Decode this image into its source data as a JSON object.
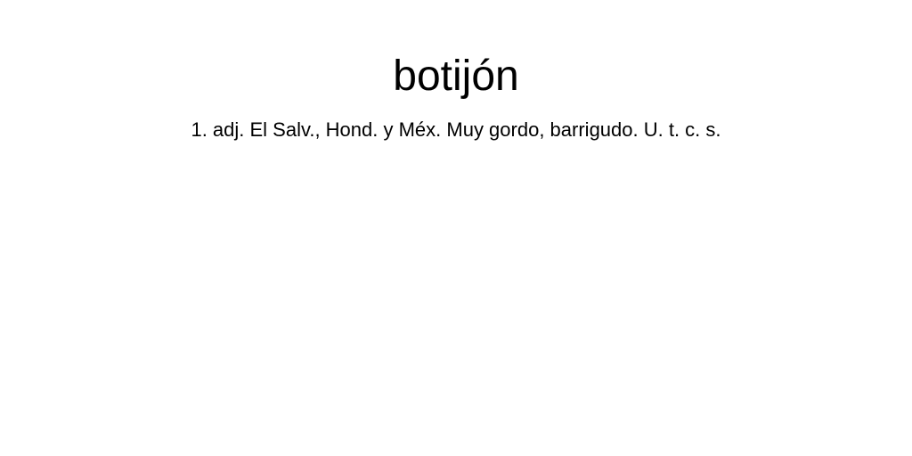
{
  "entry": {
    "headword": "botijón",
    "definition": "1. adj. El Salv., Hond. y Méx. Muy gordo, barrigudo. U. t. c. s."
  },
  "colors": {
    "background": "#ffffff",
    "text": "#000000"
  }
}
